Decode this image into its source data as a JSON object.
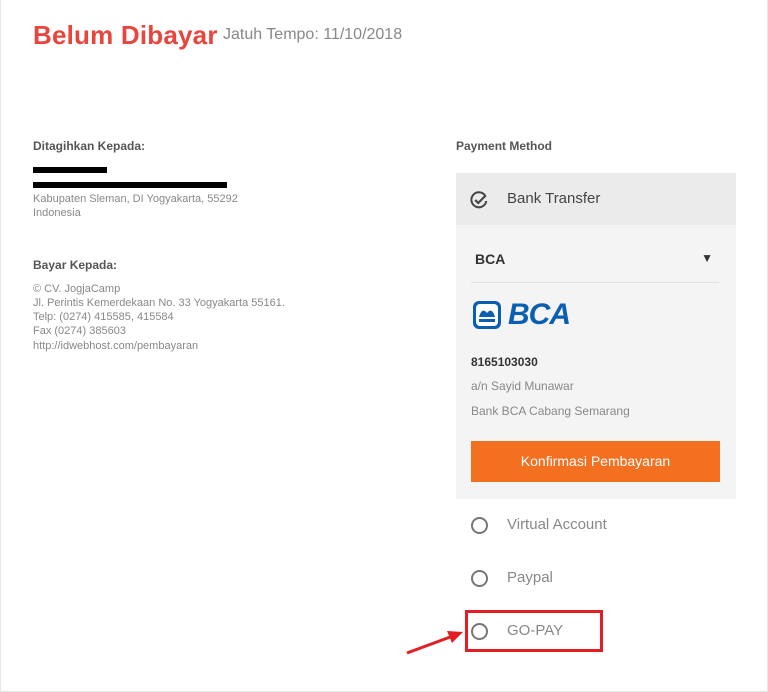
{
  "header": {
    "status": "Belum Dibayar",
    "due_date": "Jatuh Tempo: 11/10/2018"
  },
  "billed_to": {
    "title": "Ditagihkan Kepada:",
    "address_line": "Kabupaten Sleman, DI Yogyakarta, 55292",
    "country": "Indonesia"
  },
  "pay_to": {
    "title": "Bayar Kepada:",
    "lines": [
      "© CV. JogjaCamp",
      "Jl. Perintis Kemerdekaan No. 33 Yogyakarta 55161.",
      "Telp: (0274) 415585, 415584",
      "Fax (0274) 385603",
      "http://idwebhost.com/pembayaran"
    ]
  },
  "payment": {
    "title": "Payment Method",
    "selected_method": "Bank Transfer",
    "bank_select_value": "BCA",
    "bank_logo_text": "BCA",
    "account_number": "8165103030",
    "account_name": "a/n Sayid Munawar",
    "account_branch": "Bank BCA Cabang Semarang",
    "confirm_button": "Konfirmasi Pembayaran",
    "other_methods": [
      "Virtual Account",
      "Paypal",
      "GO-PAY"
    ]
  },
  "colors": {
    "status_red": "#e8453c",
    "confirm_orange": "#f37021",
    "bca_blue": "#0b5fb0",
    "highlight_red": "#e01e24"
  }
}
